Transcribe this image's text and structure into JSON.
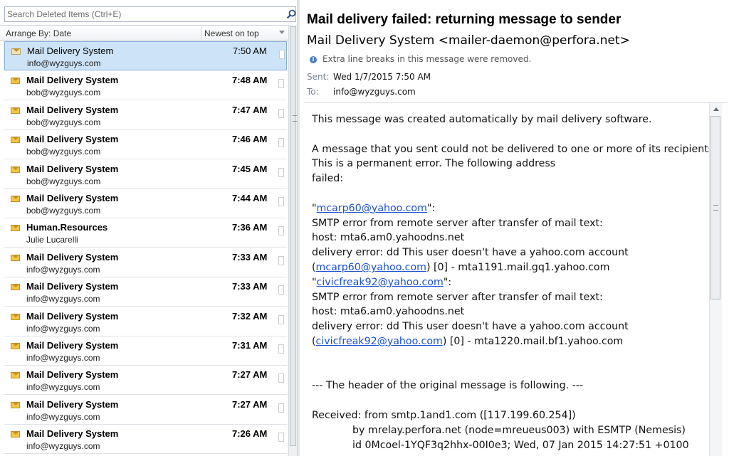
{
  "search": {
    "placeholder": "Search Deleted Items (Ctrl+E)"
  },
  "arrange": {
    "label": "Arrange By: Date",
    "order": "Newest on top"
  },
  "messages": [
    {
      "sender": "Mail Delivery System",
      "email": "info@wyzguys.com",
      "time": "7:50 AM",
      "read": true,
      "selected": true
    },
    {
      "sender": "Mail Delivery System",
      "email": "bob@wyzguys.com",
      "time": "7:48 AM",
      "read": false,
      "selected": false
    },
    {
      "sender": "Mail Delivery System",
      "email": "bob@wyzguys.com",
      "time": "7:47 AM",
      "read": false,
      "selected": false
    },
    {
      "sender": "Mail Delivery System",
      "email": "bob@wyzguys.com",
      "time": "7:46 AM",
      "read": false,
      "selected": false
    },
    {
      "sender": "Mail Delivery System",
      "email": "bob@wyzguys.com",
      "time": "7:45 AM",
      "read": false,
      "selected": false
    },
    {
      "sender": "Mail Delivery System",
      "email": "bob@wyzguys.com",
      "time": "7:44 AM",
      "read": false,
      "selected": false
    },
    {
      "sender": "Human.Resources",
      "email": "Julie Lucarelli",
      "time": "7:36 AM",
      "read": false,
      "selected": false
    },
    {
      "sender": "Mail Delivery System",
      "email": "info@wyzguys.com",
      "time": "7:33 AM",
      "read": false,
      "selected": false
    },
    {
      "sender": "Mail Delivery System",
      "email": "info@wyzguys.com",
      "time": "7:33 AM",
      "read": false,
      "selected": false
    },
    {
      "sender": "Mail Delivery System",
      "email": "info@wyzguys.com",
      "time": "7:32 AM",
      "read": false,
      "selected": false
    },
    {
      "sender": "Mail Delivery System",
      "email": "info@wyzguys.com",
      "time": "7:31 AM",
      "read": false,
      "selected": false
    },
    {
      "sender": "Mail Delivery System",
      "email": "info@wyzguys.com",
      "time": "7:27 AM",
      "read": false,
      "selected": false
    },
    {
      "sender": "Mail Delivery System",
      "email": "info@wyzguys.com",
      "time": "7:27 AM",
      "read": false,
      "selected": false
    },
    {
      "sender": "Mail Delivery System",
      "email": "info@wyzguys.com",
      "time": "7:26 AM",
      "read": false,
      "selected": false
    }
  ],
  "reading": {
    "subject": "Mail delivery failed: returning message to sender",
    "from": "Mail Delivery System <mailer-daemon@perfora.net>",
    "info": "Extra line breaks in this message were removed.",
    "sent_label": "Sent:",
    "sent_value": "Wed 1/7/2015 7:50 AM",
    "to_label": "To:",
    "to_value": "info@wyzguys.com",
    "body": [
      [
        {
          "t": "This message was created automatically by mail delivery software."
        }
      ],
      [],
      [
        {
          "t": "A message that you sent could not be delivered to one or more of its recipients."
        }
      ],
      [
        {
          "t": "This is a permanent error. The following address"
        }
      ],
      [
        {
          "t": "failed:"
        }
      ],
      [],
      [
        {
          "t": "\""
        },
        {
          "t": "mcarp60@yahoo.com",
          "link": true
        },
        {
          "t": "\":"
        }
      ],
      [
        {
          "t": "SMTP error from remote server after transfer of mail text:"
        }
      ],
      [
        {
          "t": "host: mta6.am0.yahoodns.net"
        }
      ],
      [
        {
          "t": "delivery error: dd This user doesn't have a yahoo.com account"
        }
      ],
      [
        {
          "t": "("
        },
        {
          "t": "mcarp60@yahoo.com",
          "link": true
        },
        {
          "t": ") [0] - mta1191.mail.gq1.yahoo.com"
        }
      ],
      [
        {
          "t": "\""
        },
        {
          "t": "civicfreak92@yahoo.com",
          "link": true
        },
        {
          "t": "\":"
        }
      ],
      [
        {
          "t": "SMTP error from remote server after transfer of mail text:"
        }
      ],
      [
        {
          "t": "host: mta6.am0.yahoodns.net"
        }
      ],
      [
        {
          "t": "delivery error: dd This user doesn't have a yahoo.com account"
        }
      ],
      [
        {
          "t": "("
        },
        {
          "t": "civicfreak92@yahoo.com",
          "link": true
        },
        {
          "t": ") [0] - mta1220.mail.bf1.yahoo.com"
        }
      ],
      [],
      [],
      [
        {
          "t": "--- The header of the original message is following. ---"
        }
      ],
      [],
      [
        {
          "t": "Received: from smtp.1and1.com ([117.199.60.254])"
        }
      ],
      [
        {
          "t": "by mrelay.perfora.net (node=mreueus003) with ESMTP (Nemesis)",
          "indent": true
        }
      ],
      [
        {
          "t": "id 0Mcoel-1YQF3q2hhx-00I0e3; Wed, 07 Jan 2015 14:27:51 +0100",
          "indent": true
        }
      ]
    ]
  }
}
